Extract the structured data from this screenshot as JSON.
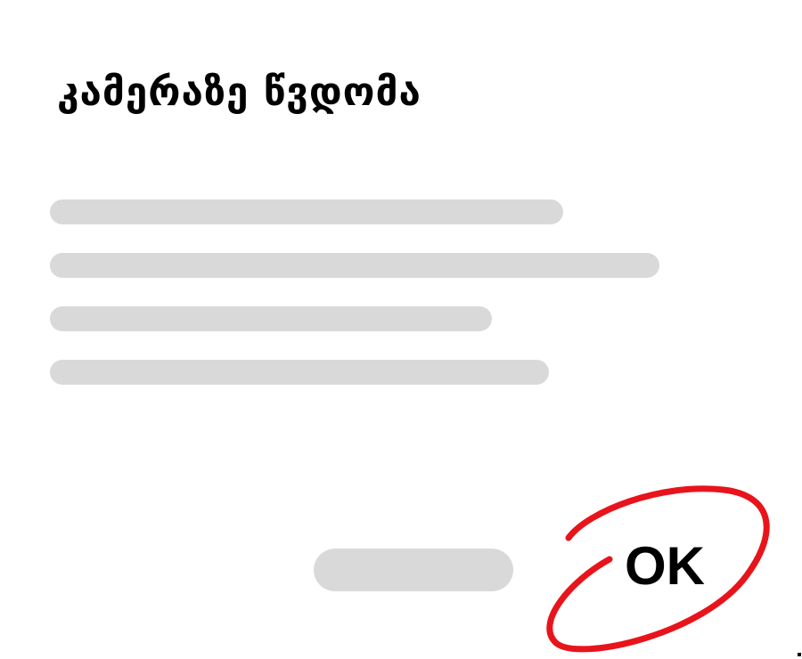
{
  "dialog": {
    "title": "კამერაზე წვდომა",
    "ok_label": "OK",
    "cancel_label": ""
  },
  "colors": {
    "background": "#ffffff",
    "placeholder": "#d9d9d9",
    "highlight": "#e8141c",
    "text": "#000000"
  }
}
